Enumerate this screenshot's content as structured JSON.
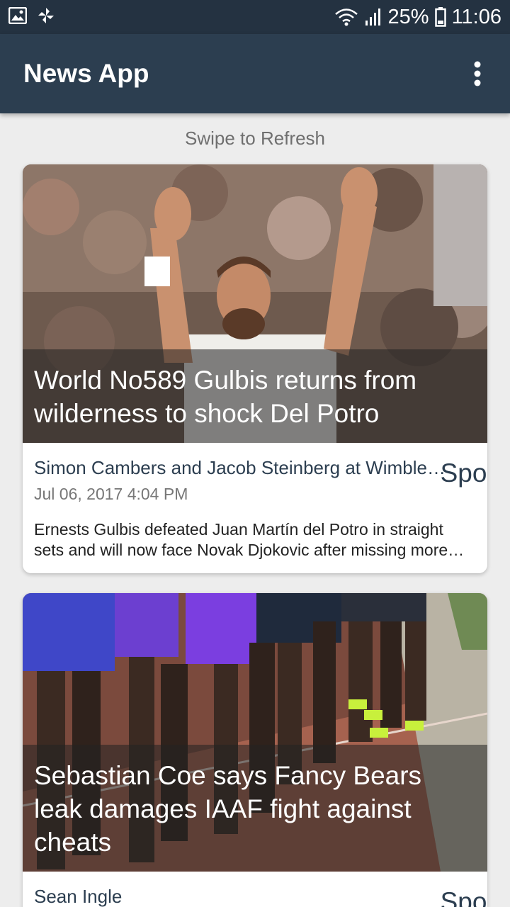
{
  "status_bar": {
    "battery": "25%",
    "time": "11:06",
    "icons": [
      "image-icon",
      "pinwheel-icon",
      "wifi-icon",
      "signal-icon",
      "battery-icon"
    ]
  },
  "app_bar": {
    "title": "News App",
    "menu_icon": "more-vert-icon"
  },
  "refresh_hint": "Swipe to Refresh",
  "articles": [
    {
      "headline": "World No589 Gulbis returns from wilderness to shock Del Potro",
      "author": "Simon Cambers and Jacob Steinberg at Wimbledon",
      "category": "Sport",
      "date": "Jul 06, 2017 4:04 PM",
      "summary": "Ernests Gulbis defeated Juan Martín del Potro in straight sets and will now face Novak Djokovic after missing more than a year through injury"
    },
    {
      "headline": "Sebastian Coe says Fancy Bears leak damages IAAF fight against cheats",
      "author": "Sean Ingle",
      "category": "Sport"
    }
  ],
  "colors": {
    "status_bar": "#243241",
    "app_bar": "#2c3e50",
    "background": "#ededed",
    "accent_text": "#2c3e50"
  }
}
